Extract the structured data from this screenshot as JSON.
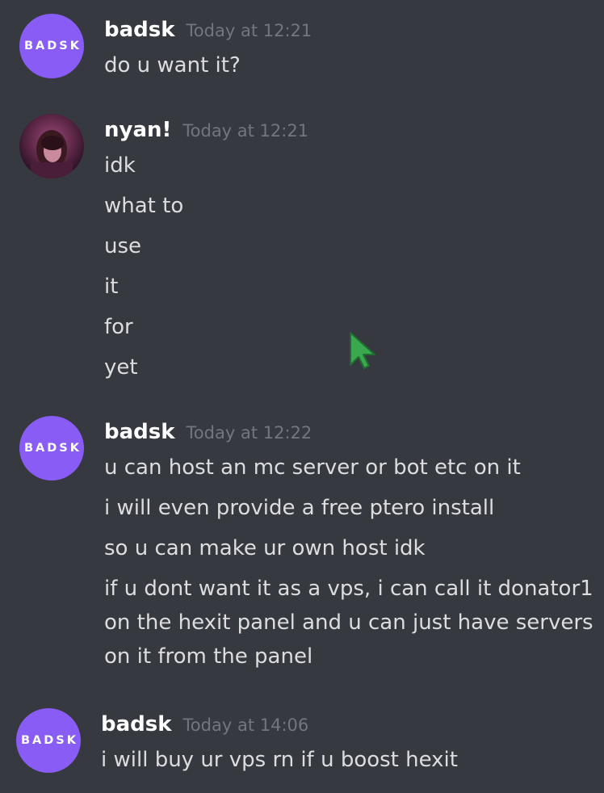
{
  "messages": [
    {
      "author": "badsk",
      "avatar_text": "BADSK",
      "timestamp": "Today at 12:21",
      "lines": [
        "do u want it?"
      ]
    },
    {
      "author": "nyan!",
      "timestamp": "Today at 12:21",
      "lines": [
        "idk",
        "what to",
        "use",
        "it",
        "for",
        "yet"
      ]
    },
    {
      "author": "badsk",
      "avatar_text": "BADSK",
      "timestamp": "Today at 12:22",
      "lines": [
        "u can host an mc server or bot etc on it",
        "i will even provide a free ptero install",
        "so u can make ur own host idk",
        "if u dont want it as a vps, i can call it donator1 on the hexit panel and u can just have servers on it from the panel"
      ]
    },
    {
      "author": "badsk",
      "avatar_text": "BADSK",
      "timestamp": "Today at 14:06",
      "lines": [
        "i will buy ur vps rn if u boost hexit"
      ]
    }
  ],
  "colors": {
    "background": "#36393f",
    "avatar_purple": "#8a5cf6",
    "username": "#ffffff",
    "timestamp": "#72767d",
    "message_text": "#dcddde",
    "cursor_green": "#3aa84f"
  },
  "icons": {
    "cursor": "mouse-pointer-icon"
  }
}
